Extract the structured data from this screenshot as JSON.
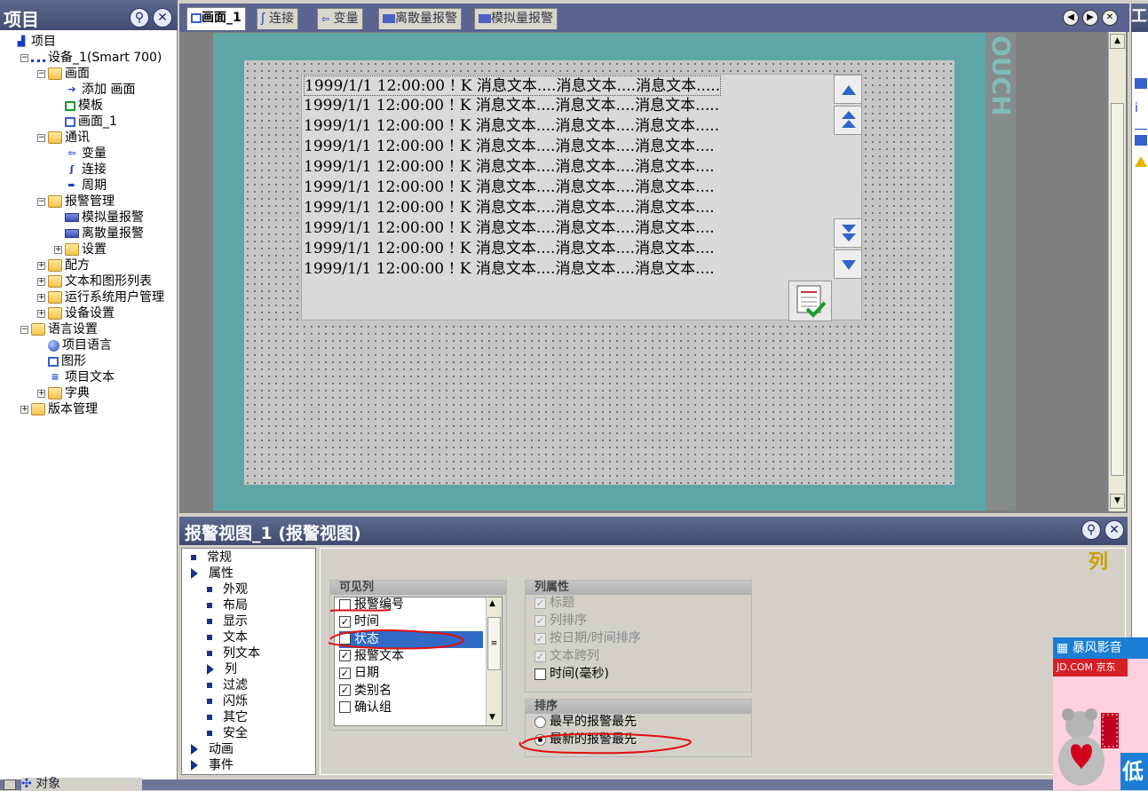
{
  "project_panel": {
    "title": "项目",
    "tree": [
      {
        "label": "项目",
        "icon": "project-icon",
        "indent": 0,
        "toggle": ""
      },
      {
        "label": "设备_1(Smart 700)",
        "icon": "device-icon",
        "indent": 1,
        "toggle": "−"
      },
      {
        "label": "画面",
        "icon": "folder-icon",
        "indent": 2,
        "toggle": "−"
      },
      {
        "label": "添加 画面",
        "icon": "add-screen-icon",
        "indent": 3,
        "toggle": ""
      },
      {
        "label": "模板",
        "icon": "template-icon",
        "indent": 3,
        "toggle": ""
      },
      {
        "label": "画面_1",
        "icon": "screen-icon",
        "indent": 3,
        "toggle": ""
      },
      {
        "label": "通讯",
        "icon": "folder-icon",
        "indent": 2,
        "toggle": "−"
      },
      {
        "label": "变量",
        "icon": "tag-icon",
        "indent": 3,
        "toggle": ""
      },
      {
        "label": "连接",
        "icon": "connection-icon",
        "indent": 3,
        "toggle": ""
      },
      {
        "label": "周期",
        "icon": "cycle-icon",
        "indent": 3,
        "toggle": ""
      },
      {
        "label": "报警管理",
        "icon": "folder-icon",
        "indent": 2,
        "toggle": "−"
      },
      {
        "label": "模拟量报警",
        "icon": "analog-alarm-icon",
        "indent": 3,
        "toggle": ""
      },
      {
        "label": "离散量报警",
        "icon": "discrete-alarm-icon",
        "indent": 3,
        "toggle": ""
      },
      {
        "label": "设置",
        "icon": "folder-icon",
        "indent": 3,
        "toggle": "+"
      },
      {
        "label": "配方",
        "icon": "folder-icon",
        "indent": 2,
        "toggle": "+"
      },
      {
        "label": "文本和图形列表",
        "icon": "folder-icon",
        "indent": 2,
        "toggle": "+"
      },
      {
        "label": "运行系统用户管理",
        "icon": "folder-icon",
        "indent": 2,
        "toggle": "+"
      },
      {
        "label": "设备设置",
        "icon": "folder-icon",
        "indent": 2,
        "toggle": "+"
      },
      {
        "label": "语言设置",
        "icon": "folder-icon",
        "indent": 1,
        "toggle": "−"
      },
      {
        "label": "项目语言",
        "icon": "globe-icon",
        "indent": 2,
        "toggle": ""
      },
      {
        "label": "图形",
        "icon": "graphics-icon",
        "indent": 2,
        "toggle": ""
      },
      {
        "label": "项目文本",
        "icon": "text-icon",
        "indent": 2,
        "toggle": ""
      },
      {
        "label": "字典",
        "icon": "folder-icon",
        "indent": 2,
        "toggle": "+"
      },
      {
        "label": "版本管理",
        "icon": "folder-icon",
        "indent": 1,
        "toggle": "+"
      }
    ]
  },
  "tabs": [
    {
      "label": "画面_1",
      "active": true
    },
    {
      "label": "连接",
      "active": false
    },
    {
      "label": "变量",
      "active": false
    },
    {
      "label": "离散量报警",
      "active": false
    },
    {
      "label": "模拟量报警",
      "active": false
    }
  ],
  "hmi": {
    "side_label": "OUCH",
    "alarm_rows": [
      "1999/1/1 12:00:00 ! K 消息文本....消息文本....消息文本.....",
      "1999/1/1 12:00:00 ! K 消息文本....消息文本....消息文本.....",
      "1999/1/1 12:00:00 ! K 消息文本....消息文本....消息文本.....",
      "1999/1/1 12:00:00 ! K 消息文本....消息文本....消息文本....",
      "1999/1/1 12:00:00 ! K 消息文本....消息文本....消息文本....",
      "1999/1/1 12:00:00 ! K 消息文本....消息文本....消息文本....",
      "1999/1/1 12:00:00 ! K 消息文本....消息文本....消息文本....",
      "1999/1/1 12:00:00 ! K 消息文本....消息文本....消息文本....",
      "1999/1/1 12:00:00 ! K 消息文本....消息文本....消息文本....",
      "1999/1/1 12:00:00 ! K 消息文本....消息文本....消息文本...."
    ]
  },
  "properties": {
    "title": "报警视图_1 (报警视图)",
    "section_label": "列",
    "nav": [
      {
        "label": "常规",
        "level": 0,
        "marker": "bullet"
      },
      {
        "label": "属性",
        "level": 0,
        "marker": "arrow"
      },
      {
        "label": "外观",
        "level": 1,
        "marker": "bullet"
      },
      {
        "label": "布局",
        "level": 1,
        "marker": "bullet"
      },
      {
        "label": "显示",
        "level": 1,
        "marker": "bullet"
      },
      {
        "label": "文本",
        "level": 1,
        "marker": "bullet"
      },
      {
        "label": "列文本",
        "level": 1,
        "marker": "bullet"
      },
      {
        "label": "列",
        "level": 1,
        "marker": "arrow"
      },
      {
        "label": "过滤",
        "level": 1,
        "marker": "bullet"
      },
      {
        "label": "闪烁",
        "level": 1,
        "marker": "bullet"
      },
      {
        "label": "其它",
        "level": 1,
        "marker": "bullet"
      },
      {
        "label": "安全",
        "level": 1,
        "marker": "bullet"
      },
      {
        "label": "动画",
        "level": 0,
        "marker": "arrow"
      },
      {
        "label": "事件",
        "level": 0,
        "marker": "arrow"
      }
    ],
    "visible_columns": {
      "header": "可见列",
      "items": [
        {
          "label": "报警编号",
          "checked": false
        },
        {
          "label": "时间",
          "checked": true
        },
        {
          "label": "状态",
          "checked": true,
          "selected": true
        },
        {
          "label": "报警文本",
          "checked": true
        },
        {
          "label": "日期",
          "checked": true
        },
        {
          "label": "类别名",
          "checked": true
        },
        {
          "label": "确认组",
          "checked": false
        }
      ]
    },
    "column_props": {
      "header": "列属性",
      "items": [
        {
          "label": "标题",
          "checked": true,
          "disabled": true
        },
        {
          "label": "列排序",
          "checked": true,
          "disabled": true
        },
        {
          "label": "按日期/时间排序",
          "checked": true,
          "disabled": true
        },
        {
          "label": "文本跨列",
          "checked": true,
          "disabled": true
        },
        {
          "label": "时间(毫秒)",
          "checked": false,
          "disabled": false
        }
      ]
    },
    "sort": {
      "header": "排序",
      "options": [
        {
          "label": "最早的报警最先",
          "selected": false
        },
        {
          "label": "最新的报警最先",
          "selected": true
        }
      ]
    }
  },
  "bottom": {
    "objects_tab": "对象"
  },
  "toolbox": {
    "title": "工"
  },
  "ad": {
    "brand": "暴风影音",
    "store": "JD.COM 京东",
    "teaser": "低"
  },
  "colors": {
    "title_bar": "#4a5680",
    "hmi_frame": "#5ea6a6",
    "selection": "#3169c6",
    "annotation": "#e01010",
    "section_label": "#c9a000"
  }
}
